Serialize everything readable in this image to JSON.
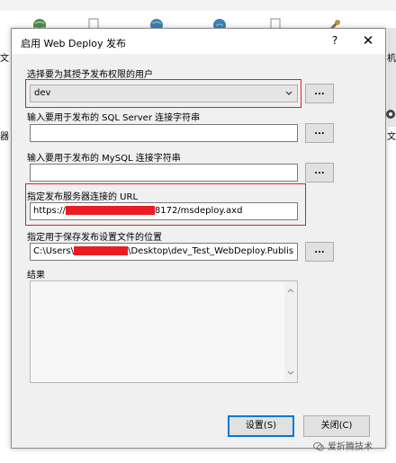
{
  "background": {
    "left_chars": [
      "文",
      "器"
    ],
    "right_chars": [
      "机",
      "文"
    ]
  },
  "dialog": {
    "title": "启用 Web Deploy 发布",
    "help_label": "?",
    "close_label": "✕",
    "user_label": "选择要为其授予发布权限的用户",
    "user_value": "dev",
    "browse_label": "...",
    "sql_label": "输入要用于发布的 SQL Server 连接字符串",
    "sql_value": "",
    "mysql_label": "输入要用于发布的 MySQL 连接字符串",
    "mysql_value": "",
    "url_label": "指定发布服务器连接的 URL",
    "url_prefix": "https://",
    "url_suffix": "8172/msdeploy.axd",
    "path_label": "指定用于保存发布设置文件的位置",
    "path_prefix": "C:\\Users\\",
    "path_suffix": "\\Desktop\\dev_Test_WebDeploy.Publis",
    "results_label": "结果",
    "results_value": "",
    "setup_button": "设置(S)",
    "close_button": "关闭(C)"
  },
  "watermark": "爱折腾技术",
  "colors": {
    "highlight": "#e02020",
    "redaction": "#ec1c24",
    "default_button_border": "#0078d7"
  },
  "icons": [
    "dropdown-chevron-icon",
    "scroll-up-icon",
    "scroll-down-icon",
    "wechat-icon"
  ]
}
